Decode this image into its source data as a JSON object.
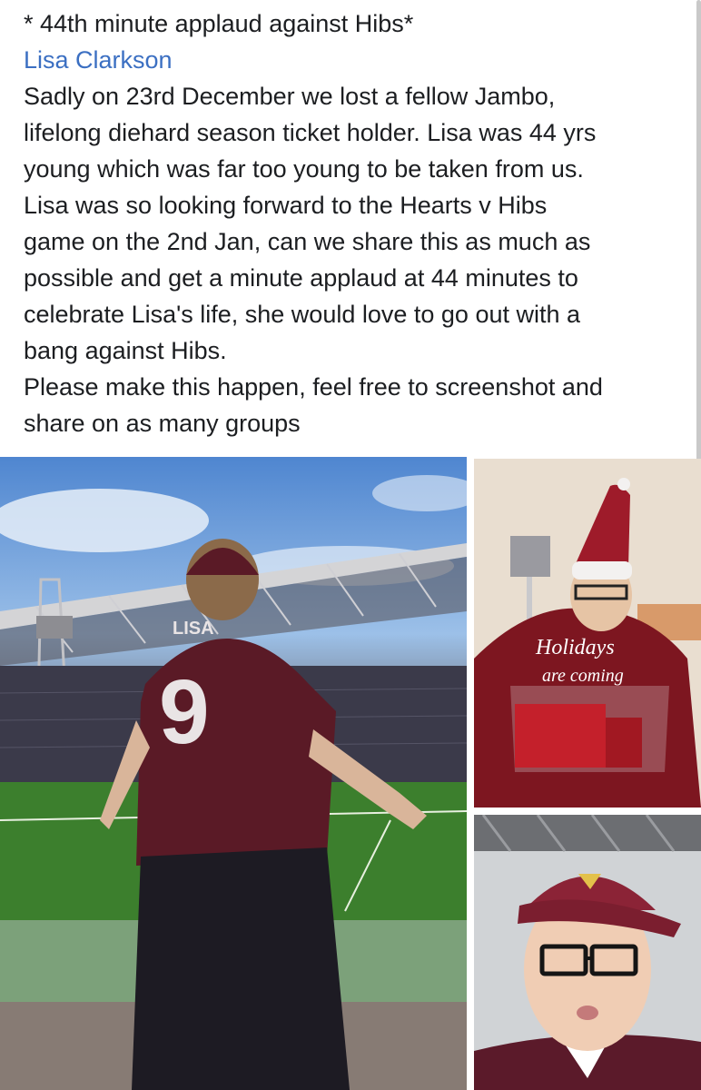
{
  "post": {
    "title": "* 44th minute applaud against Hibs*",
    "author": "Lisa Clarkson",
    "body_lines": [
      "Sadly on 23rd December we lost a fellow Jambo,",
      "lifelong diehard season ticket holder. Lisa was 44 yrs",
      "young which was far too young to be taken from us.",
      "Lisa was so looking forward to the Hearts v Hibs",
      "game on the 2nd Jan, can we share this as much as",
      "possible and get a minute applaud at 44 minutes to",
      "celebrate Lisa's life, she would love to go out with a",
      "bang against Hibs.",
      "Please make this happen, feel free to screenshot and",
      "share on as many groups"
    ]
  },
  "photos": {
    "shirt_name": "LISA",
    "shirt_number": "9",
    "jumper_text_1": "Holidays",
    "jumper_text_2": "are coming"
  }
}
